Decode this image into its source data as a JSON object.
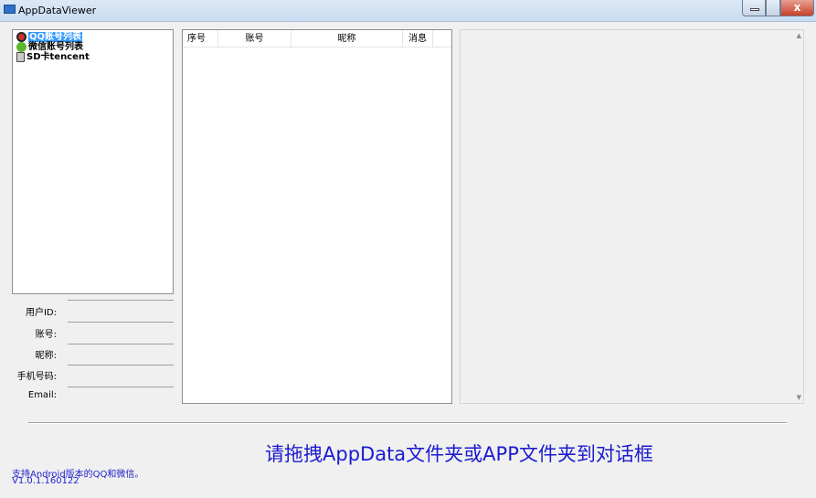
{
  "window": {
    "title": "AppDataViewer",
    "close_label": "x"
  },
  "tree": {
    "items": [
      {
        "label": "QQ账号列表",
        "icon": "qq-penguin-icon",
        "selected": true
      },
      {
        "label": "微信账号列表",
        "icon": "wechat-icon"
      },
      {
        "label": "SD卡tencent",
        "icon": "sd-card-icon"
      }
    ]
  },
  "list": {
    "columns": [
      "序号",
      "账号",
      "昵称",
      "消息"
    ]
  },
  "fields": [
    {
      "label": "用户ID:",
      "value": ""
    },
    {
      "label": "账号:",
      "value": ""
    },
    {
      "label": "昵称:",
      "value": ""
    },
    {
      "label": "手机号码:",
      "value": ""
    },
    {
      "label": "Email:",
      "value": ""
    }
  ],
  "drop_hint": "请拖拽AppData文件夹或APP文件夹到对话框",
  "footer": {
    "support": "支持Android版本的QQ和微信。",
    "version": "V1.0.1.160122"
  },
  "colors": {
    "accent": "#1a1ad0",
    "selection": "#3399ff"
  }
}
